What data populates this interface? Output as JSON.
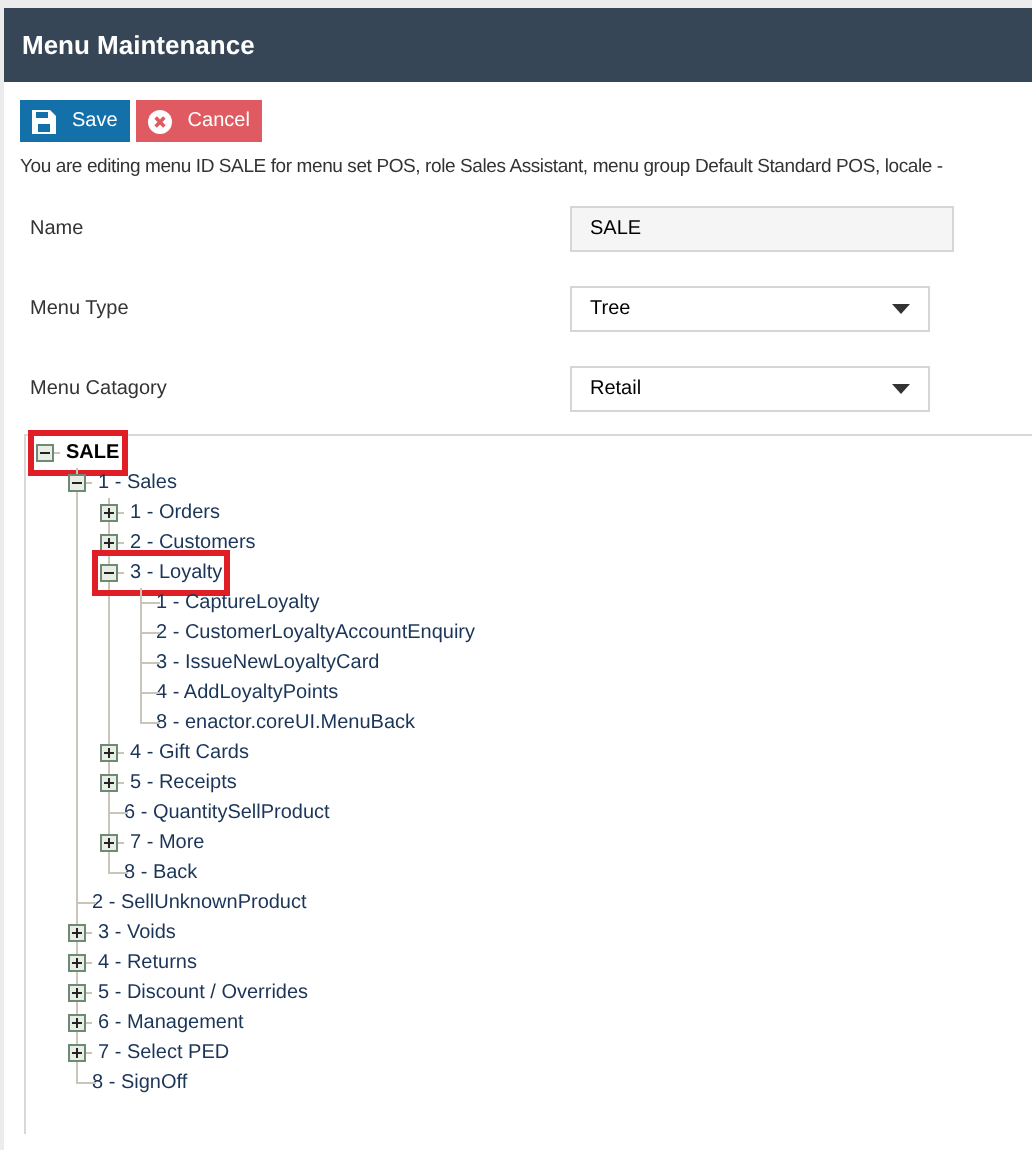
{
  "window": {
    "title": "Menu Maintenance"
  },
  "buttons": [
    {
      "kind": "save",
      "label": "Save"
    },
    {
      "kind": "cancel",
      "label": "Cancel"
    }
  ],
  "info": "You are editing menu ID SALE for menu set POS, role Sales Assistant, menu group Default Standard POS, locale -",
  "fields": [
    {
      "kind": "text",
      "label": "Name",
      "value": "SALE"
    },
    {
      "kind": "select",
      "label": "Menu Type",
      "value": "Tree"
    },
    {
      "kind": "select",
      "label": "Menu Catagory",
      "value": "Retail"
    }
  ],
  "tree": [
    {
      "label": "SALE",
      "expanded": true,
      "highlighted": true,
      "children": [
        {
          "label": "1 - Sales",
          "expanded": true,
          "highlighted": false,
          "children": [
            {
              "label": "1 - Orders",
              "expanded": false,
              "highlighted": false
            },
            {
              "label": "2 - Customers",
              "expanded": false,
              "highlighted": false
            },
            {
              "label": "3 - Loyalty",
              "expanded": true,
              "highlighted": true,
              "children": [
                {
                  "label": "1 - CaptureLoyalty",
                  "highlighted": false
                },
                {
                  "label": "2 - CustomerLoyaltyAccountEnquiry",
                  "highlighted": false
                },
                {
                  "label": "3 - IssueNewLoyaltyCard",
                  "highlighted": false
                },
                {
                  "label": "4 - AddLoyaltyPoints",
                  "highlighted": false
                },
                {
                  "label": "8 - enactor.coreUI.MenuBack",
                  "highlighted": false
                }
              ]
            },
            {
              "label": "4 - Gift Cards",
              "expanded": false,
              "highlighted": false
            },
            {
              "label": "5 - Receipts",
              "expanded": false,
              "highlighted": false
            },
            {
              "label": "6 - QuantitySellProduct",
              "highlighted": false
            },
            {
              "label": "7 - More",
              "expanded": false,
              "highlighted": false
            },
            {
              "label": "8 - Back",
              "highlighted": false
            }
          ]
        },
        {
          "label": "2 - SellUnknownProduct",
          "highlighted": false
        },
        {
          "label": "3 - Voids",
          "expanded": false,
          "highlighted": false
        },
        {
          "label": "4 - Returns",
          "expanded": false,
          "highlighted": false
        },
        {
          "label": "5 - Discount / Overrides",
          "expanded": false,
          "highlighted": false
        },
        {
          "label": "6 - Management",
          "expanded": false,
          "highlighted": false
        },
        {
          "label": "7 - Select PED",
          "expanded": false,
          "highlighted": false
        },
        {
          "label": "8 - SignOff",
          "highlighted": false
        }
      ]
    }
  ]
}
